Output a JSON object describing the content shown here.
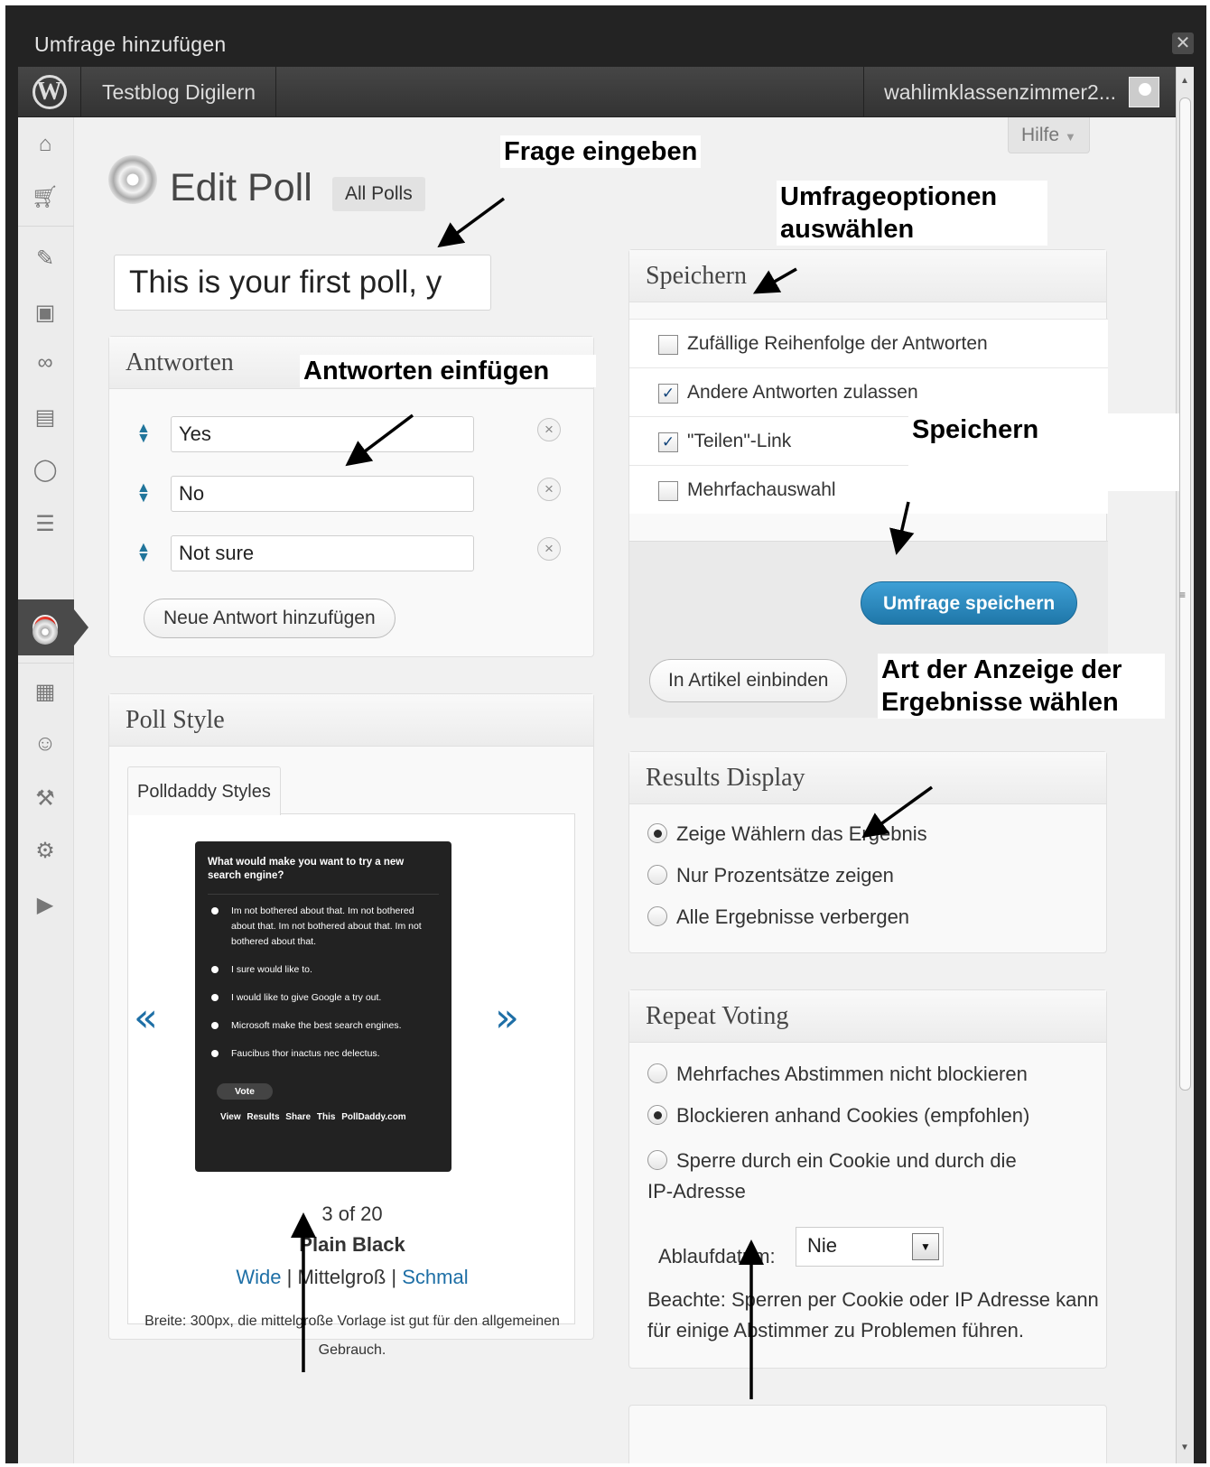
{
  "window": {
    "title": "Umfrage hinzufügen",
    "close": "✕"
  },
  "admin_bar": {
    "site_name": "Testblog Digilern",
    "account": "wahlimklassenzimmer2..."
  },
  "help": {
    "label": "Hilfe",
    "caret": "▼"
  },
  "page": {
    "title": "Edit Poll",
    "all_polls": "All Polls"
  },
  "question": {
    "value": "This is your first poll, y"
  },
  "answers": {
    "title": "Antworten",
    "items": [
      "Yes",
      "No",
      "Not sure"
    ],
    "add_label": "Neue Antwort hinzufügen"
  },
  "poll_style": {
    "title": "Poll Style",
    "tab": "Polldaddy Styles",
    "prev": "«",
    "next": "»",
    "preview": {
      "question": "What would make you want to try a new search engine?",
      "options": [
        "Im not bothered about that. Im not bothered about that. Im not bothered about that. Im not bothered about that.",
        "I sure would like to.",
        "I would like to give Google a try out.",
        "Microsoft make the best search engines.",
        "Faucibus thor inactus nec delectus."
      ],
      "vote": "Vote",
      "links": "View Results  Share This  PollDaddy.com"
    },
    "count": "3 of 20",
    "name": "Plain Black",
    "sizes": {
      "wide": "Wide",
      "sep1": " | ",
      "medium": "Mittelgroß",
      "sep2": " | ",
      "narrow": "Schmal"
    },
    "description": "Breite: 300px, die mittelgroße Vorlage ist gut für den allgemeinen Gebrauch."
  },
  "save_box": {
    "title": "Speichern",
    "options": [
      {
        "label": "Zufällige Reihenfolge der Antworten",
        "checked": false
      },
      {
        "label": "Andere Antworten zulassen",
        "checked": true
      },
      {
        "label": "\"Teilen\"-Link",
        "checked": true
      },
      {
        "label": "Mehrfachauswahl",
        "checked": false
      }
    ],
    "check_mark": "✓",
    "save_button": "Umfrage speichern",
    "embed_button": "In Artikel einbinden"
  },
  "results_display": {
    "title": "Results Display",
    "options": [
      "Zeige Wählern das Ergebnis",
      "Nur Prozentsätze zeigen",
      "Alle Ergebnisse verbergen"
    ],
    "selected_index": 0
  },
  "repeat_voting": {
    "title": "Repeat Voting",
    "options": [
      "Mehrfaches Abstimmen nicht blockieren",
      "Blockieren anhand Cookies (empfohlen)",
      "Sperre durch ein Cookie und durch die IP-Adresse"
    ],
    "selected_index": 1,
    "expiry_label": "Ablaufdatum:",
    "expiry_value": "Nie",
    "expiry_arrow": "▼",
    "note": "Beachte: Sperren per Cookie oder IP Adresse kann für einige Abstimmer zu Problemen führen."
  },
  "annotations": {
    "frage": "Frage eingeben",
    "optionen": "Umfrageoptionen auswählen",
    "antworten": "Antworten einfügen",
    "speichern": "Speichern",
    "anzeige": "Art der Anzeige der Ergebnisse wählen"
  },
  "icons": {
    "sidebar": [
      "home-icon",
      "cart-icon",
      "pin-icon",
      "media-icon",
      "link-icon",
      "pages-icon",
      "comments-icon",
      "feedback-icon",
      "polls-icon",
      "ratings-icon",
      "appearance-icon",
      "users-icon",
      "tools-icon",
      "settings-icon",
      "play-icon"
    ],
    "accent": "#21759b",
    "save_button_color": "#2a8bc2",
    "active_poll_color": "#d0150a"
  }
}
